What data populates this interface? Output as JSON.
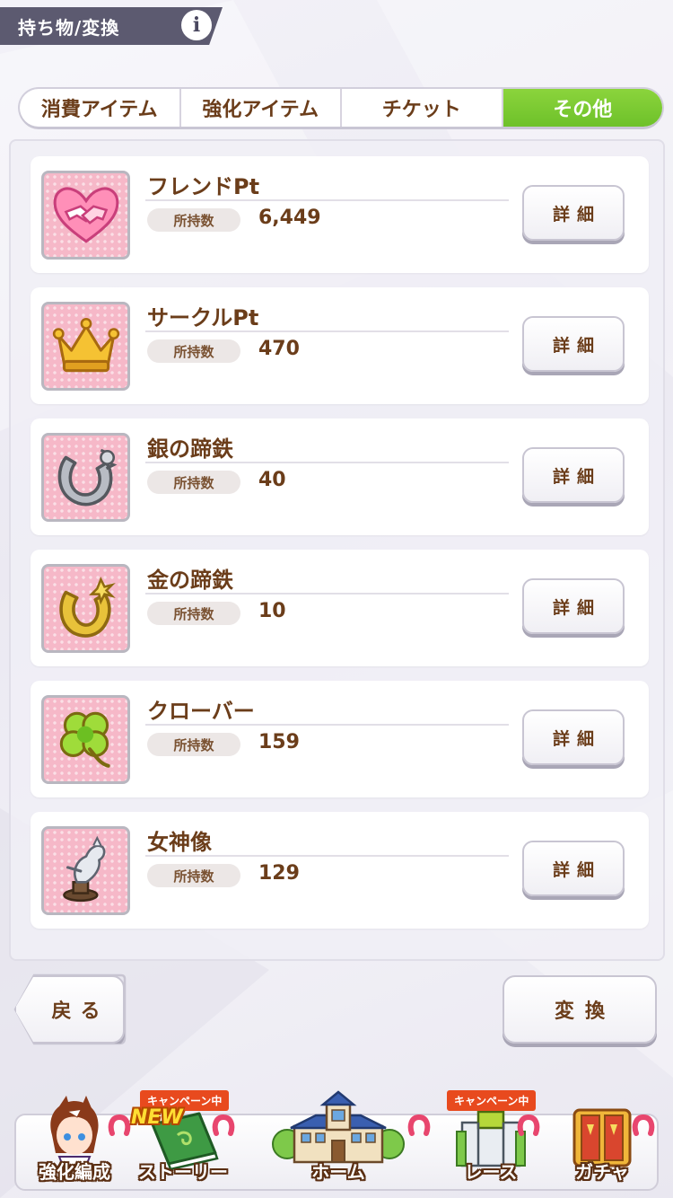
{
  "header": {
    "title": "持ち物/変換",
    "info_icon": "info-icon"
  },
  "tabs": [
    {
      "label": "消費アイテム",
      "active": false
    },
    {
      "label": "強化アイテム",
      "active": false
    },
    {
      "label": "チケット",
      "active": false
    },
    {
      "label": "その他",
      "active": true
    }
  ],
  "items": [
    {
      "name": "フレンドPt",
      "qty_label": "所持数",
      "qty": "6,449",
      "icon": "handshake-heart-icon",
      "detail_label": "詳細"
    },
    {
      "name": "サークルPt",
      "qty_label": "所持数",
      "qty": "470",
      "icon": "crown-icon",
      "detail_label": "詳細"
    },
    {
      "name": "銀の蹄鉄",
      "qty_label": "所持数",
      "qty": "40",
      "icon": "silver-horseshoe-icon",
      "detail_label": "詳細"
    },
    {
      "name": "金の蹄鉄",
      "qty_label": "所持数",
      "qty": "10",
      "icon": "gold-horseshoe-icon",
      "detail_label": "詳細"
    },
    {
      "name": "クローバー",
      "qty_label": "所持数",
      "qty": "159",
      "icon": "clover-icon",
      "detail_label": "詳細"
    },
    {
      "name": "女神像",
      "qty_label": "所持数",
      "qty": "129",
      "icon": "goddess-statue-icon",
      "detail_label": "詳細"
    }
  ],
  "buttons": {
    "back": "戻る",
    "exchange": "変換"
  },
  "nav": [
    {
      "label": "強化編成",
      "badge": "",
      "icon": "character-portrait-icon"
    },
    {
      "label": "ストーリー",
      "badge": "キャンペーン中",
      "new": "NEW",
      "icon": "story-book-icon"
    },
    {
      "label": "ホーム",
      "badge": "",
      "icon": "school-building-icon"
    },
    {
      "label": "レース",
      "badge": "キャンペーン中",
      "icon": "race-gate-icon"
    },
    {
      "label": "ガチャ",
      "badge": "",
      "icon": "gacha-door-icon"
    }
  ],
  "colors": {
    "accent_green": "#7bc934",
    "text_brown": "#6b3d1a",
    "header_bg": "#5c5a70",
    "icon_bg_pink": "#f6b8c8",
    "badge_red": "#e84a1e"
  }
}
